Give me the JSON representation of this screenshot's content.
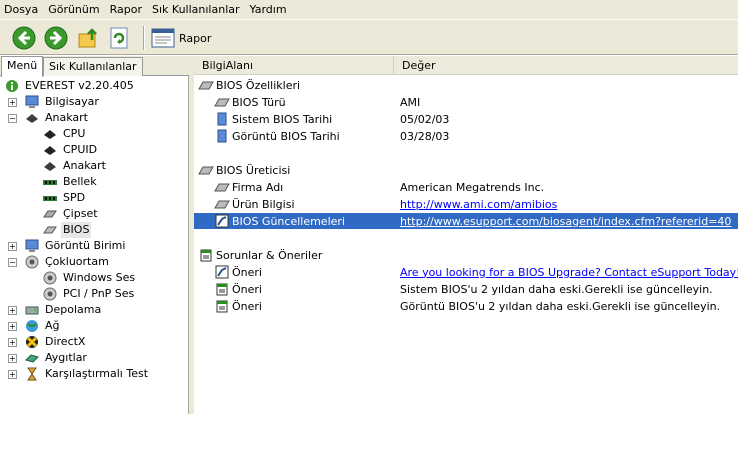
{
  "menu": [
    "Dosya",
    "Görünüm",
    "Rapor",
    "Sık Kullanılanlar",
    "Yardım"
  ],
  "toolbar": {
    "report_label": "Rapor"
  },
  "tabs": [
    "Menü",
    "Sık Kullanılanlar"
  ],
  "tree": [
    {
      "label": "EVEREST v2.20.405",
      "icon": "info-icon"
    },
    {
      "label": "Bilgisayar",
      "icon": "computer-icon"
    },
    {
      "label": "Anakart",
      "icon": "motherboard-icon"
    },
    {
      "label": "CPU",
      "icon": "cpu-icon"
    },
    {
      "label": "CPUID",
      "icon": "cpu-icon"
    },
    {
      "label": "Anakart",
      "icon": "motherboard-icon"
    },
    {
      "label": "Bellek",
      "icon": "memory-icon"
    },
    {
      "label": "SPD",
      "icon": "memory-icon"
    },
    {
      "label": "Çipset",
      "icon": "chipset-icon"
    },
    {
      "label": "BIOS",
      "icon": "bios-chip-icon"
    },
    {
      "label": "Görüntü Birimi",
      "icon": "display-icon"
    },
    {
      "label": "Çokluortam",
      "icon": "speaker-icon"
    },
    {
      "label": "Windows Ses",
      "icon": "speaker-icon"
    },
    {
      "label": "PCI / PnP Ses",
      "icon": "speaker-icon"
    },
    {
      "label": "Depolama",
      "icon": "storage-icon"
    },
    {
      "label": "Ağ",
      "icon": "network-icon"
    },
    {
      "label": "DirectX",
      "icon": "directx-icon"
    },
    {
      "label": "Aygıtlar",
      "icon": "devices-icon"
    },
    {
      "label": "Karşılaştırmalı Test",
      "icon": "hourglass-icon"
    }
  ],
  "columns": [
    "BilgiAlanı",
    "Değer"
  ],
  "rows": [
    {
      "name": "BIOS Özellikleri",
      "value": ""
    },
    {
      "name": "BIOS Türü",
      "value": "AMI"
    },
    {
      "name": "Sistem BIOS Tarihi",
      "value": "05/02/03"
    },
    {
      "name": "Görüntü BIOS Tarihi",
      "value": "03/28/03"
    },
    {
      "name": "BIOS Üreticisi",
      "value": ""
    },
    {
      "name": "Firma Adı",
      "value": "American Megatrends Inc."
    },
    {
      "name": "Ürün Bilgisi",
      "value": "http://www.ami.com/amibios"
    },
    {
      "name": "BIOS Güncellemeleri",
      "value": "http://www.esupport.com/biosagent/index.cfm?refererid=40"
    },
    {
      "name": "Sorunlar & Öneriler",
      "value": ""
    },
    {
      "name": "Öneri",
      "value": "Are you looking for a BIOS Upgrade?  Contact eSupport Today!"
    },
    {
      "name": "Öneri",
      "value": "Sistem BIOS'u 2 yıldan daha eski.Gerekli ise güncelleyin."
    },
    {
      "name": "Öneri",
      "value": "Görüntü BIOS'u 2 yıldan daha eski.Gerekli ise güncelleyin."
    }
  ],
  "colors": {
    "selection": "#316ac5",
    "link": "#0000ff",
    "chrome": "#ece9d8"
  }
}
